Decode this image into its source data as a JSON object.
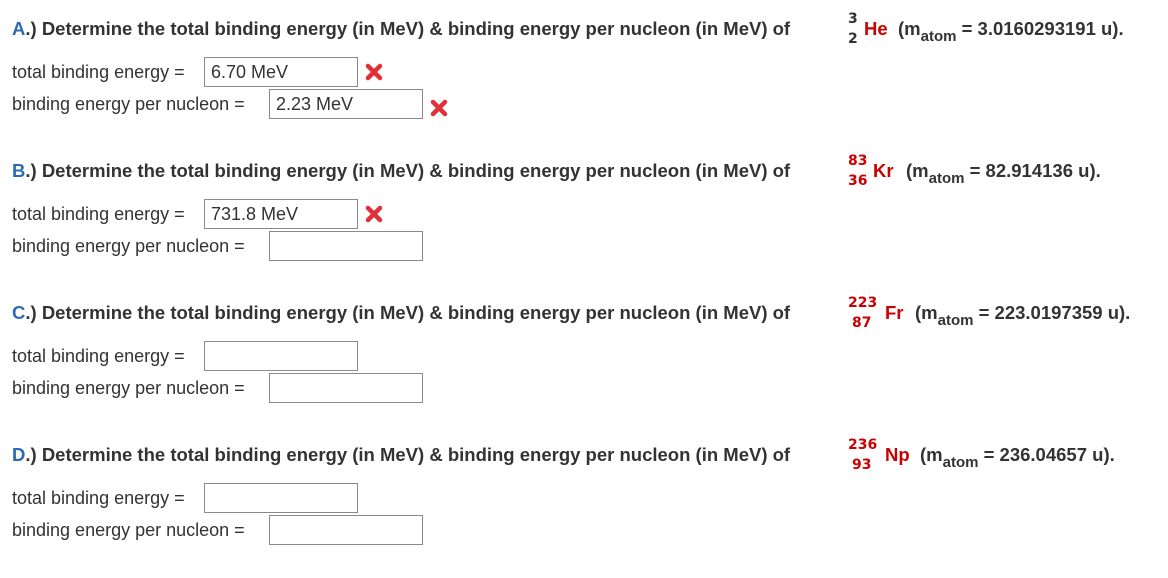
{
  "question_lead_suffix": ".) Determine the total binding energy (in MeV) & binding energy per nucleon (in MeV) of",
  "mass_label": "(m",
  "mass_sub": "atom",
  "questions": [
    {
      "letter": "A",
      "mass_number": "3",
      "atomic_number": "2",
      "symbol": "He",
      "mass_value": "= 3.0160293191 u).",
      "total_label": "total binding energy =",
      "total_value": "6.70 MeV",
      "total_status": "incorrect",
      "per_label": "binding energy per nucleon =",
      "per_value": "2.23 MeV",
      "per_status": "incorrect"
    },
    {
      "letter": "B",
      "mass_number": "83",
      "atomic_number": "36",
      "symbol": "Kr",
      "mass_value": "= 82.914136 u).",
      "total_label": "total binding energy =",
      "total_value": "731.8 MeV",
      "total_status": "incorrect",
      "per_label": "binding energy per nucleon =",
      "per_value": "",
      "per_status": "none"
    },
    {
      "letter": "C",
      "mass_number": "223",
      "atomic_number": "87",
      "symbol": "Fr",
      "mass_value": "= 223.0197359 u).",
      "total_label": "total binding energy =",
      "total_value": "",
      "total_status": "none",
      "per_label": "binding energy per nucleon =",
      "per_value": "",
      "per_status": "none"
    },
    {
      "letter": "D",
      "mass_number": "236",
      "atomic_number": "93",
      "symbol": "Np",
      "mass_value": "= 236.04657 u).",
      "total_label": "total binding energy =",
      "total_value": "",
      "total_status": "none",
      "per_label": "binding energy per nucleon =",
      "per_value": "",
      "per_status": "none"
    }
  ],
  "colors": {
    "question_letter": "#2b6cb0",
    "nuclide": "#cc0000",
    "incorrect_mark": "#e0303a",
    "text": "#333333"
  },
  "icons": {
    "incorrect": "x-mark-icon"
  }
}
